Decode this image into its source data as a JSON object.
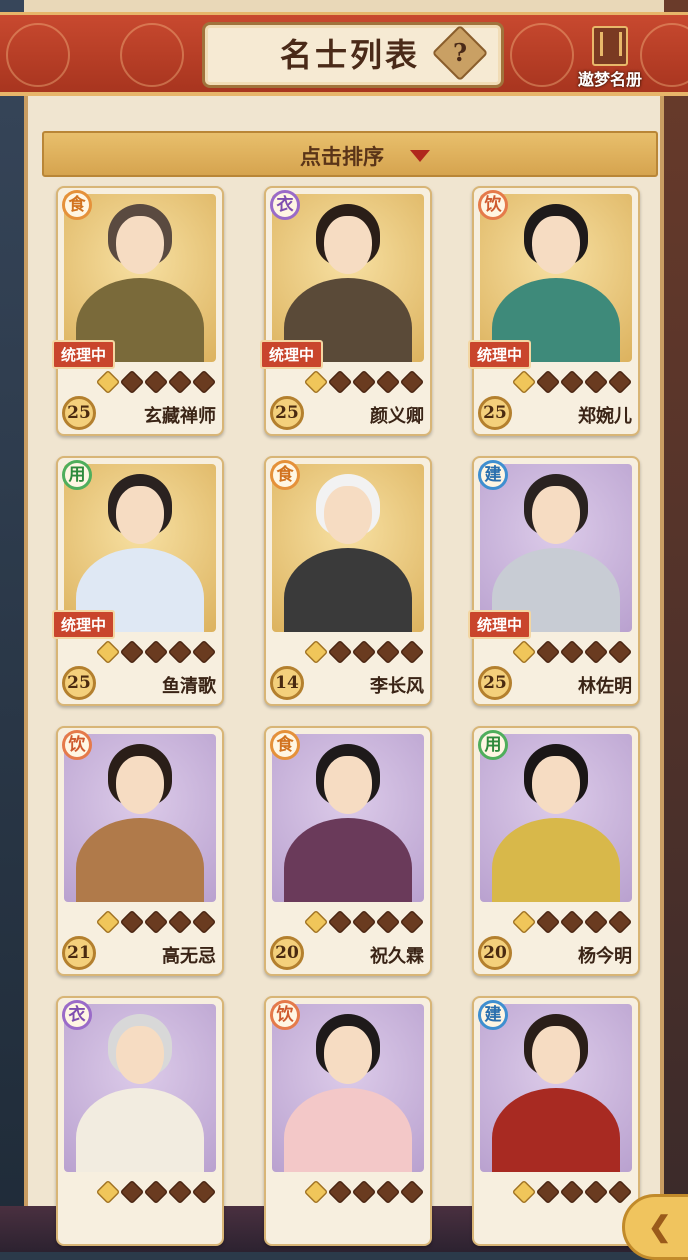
{
  "header": {
    "title": "名士列表",
    "help_symbol": "?",
    "book_label": "遨梦名册"
  },
  "sort": {
    "label": "点击排序"
  },
  "colors": {
    "header_red": "#c8492f",
    "panel": "#f0e5d0",
    "sort_bar": "#e8bf6c",
    "tag_red": "#c9452c"
  },
  "cards": [
    {
      "name": "玄藏禅师",
      "level": "25",
      "role": "食",
      "role_type": "food",
      "tag": "统理中",
      "stars_filled": 1,
      "stars_total": 5,
      "bg": "gold"
    },
    {
      "name": "颜义卿",
      "level": "25",
      "role": "衣",
      "role_type": "clothes",
      "tag": "统理中",
      "stars_filled": 1,
      "stars_total": 5,
      "bg": "gold"
    },
    {
      "name": "郑婉儿",
      "level": "25",
      "role": "饮",
      "role_type": "drink",
      "tag": "统理中",
      "stars_filled": 1,
      "stars_total": 5,
      "bg": "gold"
    },
    {
      "name": "鱼清歌",
      "level": "25",
      "role": "用",
      "role_type": "use",
      "tag": "统理中",
      "stars_filled": 1,
      "stars_total": 5,
      "bg": "gold"
    },
    {
      "name": "李长风",
      "level": "14",
      "role": "食",
      "role_type": "food",
      "tag": "",
      "stars_filled": 1,
      "stars_total": 5,
      "bg": "gold"
    },
    {
      "name": "林佐明",
      "level": "25",
      "role": "建",
      "role_type": "build",
      "tag": "统理中",
      "stars_filled": 1,
      "stars_total": 5,
      "bg": "purple"
    },
    {
      "name": "高无忌",
      "level": "21",
      "role": "饮",
      "role_type": "drink",
      "tag": "",
      "stars_filled": 1,
      "stars_total": 5,
      "bg": "purple"
    },
    {
      "name": "祝久霖",
      "level": "20",
      "role": "食",
      "role_type": "food",
      "tag": "",
      "stars_filled": 1,
      "stars_total": 5,
      "bg": "purple"
    },
    {
      "name": "杨今明",
      "level": "20",
      "role": "用",
      "role_type": "use",
      "tag": "",
      "stars_filled": 1,
      "stars_total": 5,
      "bg": "purple"
    },
    {
      "name": "",
      "level": "",
      "role": "衣",
      "role_type": "clothes",
      "tag": "",
      "stars_filled": 1,
      "stars_total": 5,
      "bg": "purple"
    },
    {
      "name": "",
      "level": "",
      "role": "饮",
      "role_type": "drink",
      "tag": "",
      "stars_filled": 1,
      "stars_total": 5,
      "bg": "purple"
    },
    {
      "name": "",
      "level": "",
      "role": "建",
      "role_type": "build",
      "tag": "",
      "stars_filled": 1,
      "stars_total": 5,
      "bg": "purple"
    }
  ],
  "back_button": {
    "icon": "back-arrow-icon"
  }
}
